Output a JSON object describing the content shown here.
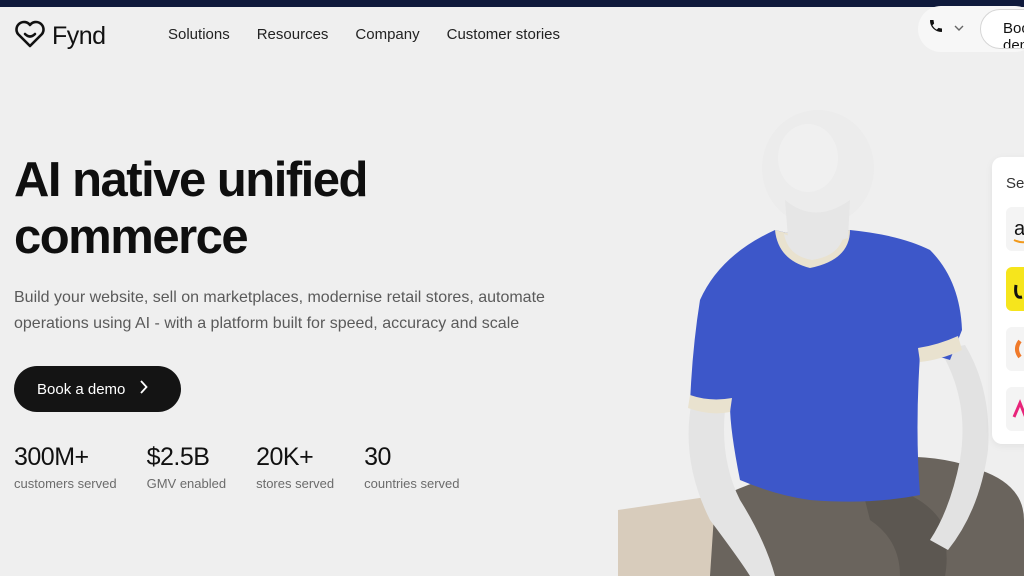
{
  "brand": {
    "name": "Fynd"
  },
  "nav": {
    "items": [
      "Solutions",
      "Resources",
      "Company",
      "Customer stories"
    ],
    "book_label": "Book a demo"
  },
  "hero": {
    "title_line1": "AI native unified",
    "title_line2": "commerce",
    "subtitle": "Build your website, sell on marketplaces, modernise retail stores, automate operations using AI - with a platform built for speed, accuracy and scale",
    "cta_label": "Book a demo"
  },
  "stats": [
    {
      "value": "300M+",
      "label": "customers served"
    },
    {
      "value": "$2.5B",
      "label": "GMV enabled"
    },
    {
      "value": "20K+",
      "label": "stores served"
    },
    {
      "value": "30",
      "label": "countries served"
    }
  ],
  "side_panel": {
    "label": "Se"
  },
  "colors": {
    "top_strip": "#0f1a3c",
    "shirt": "#3d57c9",
    "cta": "#141414"
  },
  "icons": [
    "fynd-logo-icon",
    "phone-icon",
    "chevron-down-icon",
    "chevron-right-icon"
  ]
}
